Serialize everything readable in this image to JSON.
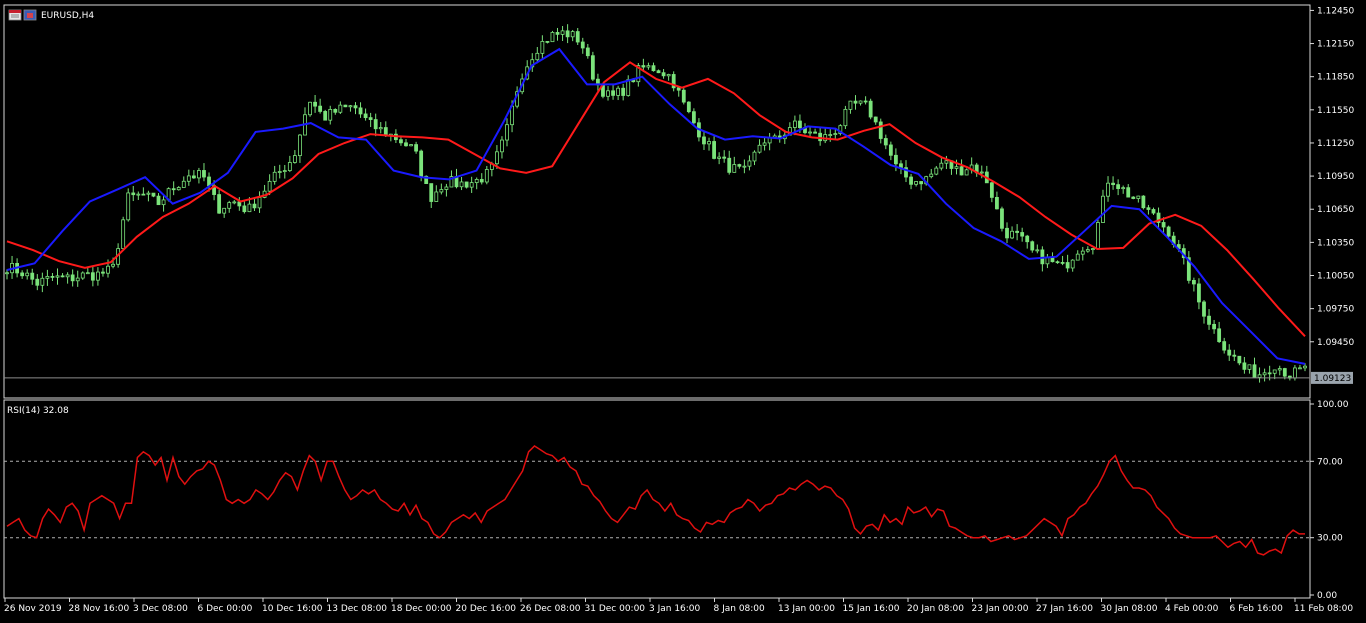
{
  "window": {
    "title": "EURUSD,H4",
    "icon": "chart-window-icon"
  },
  "colors": {
    "background": "#000000",
    "frame": "#d9d9d9",
    "bull_candle": "#7be37b",
    "ma_fast": "#1a1aff",
    "ma_slow": "#ff1a1a",
    "rsi_line": "#e01010",
    "level_line": "#b0b0b0",
    "price_tag_bg": "#9aa4ad"
  },
  "chart_data": [
    {
      "type": "candlestick",
      "symbol": "EURUSD",
      "timeframe": "H4",
      "y_ticks": [
        "1.12450",
        "1.12150",
        "1.11850",
        "1.11550",
        "1.11250",
        "1.10950",
        "1.10650",
        "1.10350",
        "1.10050",
        "1.09750",
        "1.09450"
      ],
      "ylim": [
        1.0895,
        1.1249
      ],
      "current_price": "1.09123",
      "current_price_value": 1.09123,
      "x_ticks": [
        "26 Nov 2019",
        "28 Nov 16:00",
        "3 Dec 08:00",
        "6 Dec 00:00",
        "10 Dec 16:00",
        "13 Dec 08:00",
        "18 Dec 00:00",
        "20 Dec 16:00",
        "26 Dec 08:00",
        "31 Dec 00:00",
        "3 Jan 16:00",
        "8 Jan 08:00",
        "13 Jan 00:00",
        "15 Jan 16:00",
        "20 Jan 08:00",
        "23 Jan 00:00",
        "27 Jan 16:00",
        "30 Jan 08:00",
        "4 Feb 00:00",
        "6 Feb 16:00",
        "11 Feb 08:00"
      ],
      "close_anchors": [
        1.1013,
        1.1008,
        1.0998,
        1.1003,
        1.1002,
        1.1005,
        1.1006,
        1.101,
        1.1075,
        1.1078,
        1.107,
        1.1084,
        1.1096,
        1.1095,
        1.1066,
        1.1072,
        1.1064,
        1.1082,
        1.1098,
        1.1112,
        1.1165,
        1.1148,
        1.1155,
        1.1158,
        1.1142,
        1.1135,
        1.1128,
        1.1118,
        1.1075,
        1.109,
        1.1088,
        1.109,
        1.1098,
        1.113,
        1.1185,
        1.121,
        1.1222,
        1.1225,
        1.1218,
        1.118,
        1.1165,
        1.1175,
        1.1193,
        1.1193,
        1.1185,
        1.1155,
        1.1132,
        1.1112,
        1.1102,
        1.1098,
        1.1128,
        1.1127,
        1.1142,
        1.1135,
        1.1128,
        1.1138,
        1.116,
        1.1158,
        1.113,
        1.11,
        1.109,
        1.1093,
        1.1108,
        1.11,
        1.1105,
        1.109,
        1.1045,
        1.104,
        1.1025,
        1.1018,
        1.1012,
        1.103,
        1.1035,
        1.1095,
        1.1082,
        1.1071,
        1.1058,
        1.1045,
        1.1015,
        1.098,
        1.0955,
        1.0935,
        1.092,
        1.0916,
        1.0925,
        1.0915,
        1.092
      ],
      "ma_fast": [
        1.101,
        1.1016,
        1.1045,
        1.1072,
        1.1083,
        1.1094,
        1.107,
        1.108,
        1.1098,
        1.1135,
        1.1138,
        1.1143,
        1.113,
        1.1128,
        1.11,
        1.1094,
        1.1092,
        1.11,
        1.1145,
        1.1195,
        1.121,
        1.1178,
        1.1178,
        1.1185,
        1.116,
        1.1138,
        1.1128,
        1.1131,
        1.1129,
        1.114,
        1.1138,
        1.1122,
        1.1105,
        1.1097,
        1.107,
        1.1048,
        1.1036,
        1.102,
        1.1022,
        1.1045,
        1.1068,
        1.1065,
        1.104,
        1.1013,
        1.098,
        1.0955,
        1.093,
        1.0925
      ],
      "ma_slow": [
        1.1036,
        1.1028,
        1.1018,
        1.1012,
        1.1017,
        1.104,
        1.1058,
        1.107,
        1.1086,
        1.1072,
        1.1078,
        1.1093,
        1.1115,
        1.1125,
        1.1133,
        1.1131,
        1.113,
        1.1128,
        1.1115,
        1.1102,
        1.1098,
        1.1104,
        1.1142,
        1.118,
        1.1198,
        1.1183,
        1.1175,
        1.1183,
        1.117,
        1.115,
        1.1135,
        1.113,
        1.1128,
        1.1136,
        1.1142,
        1.1125,
        1.1112,
        1.1103,
        1.109,
        1.1076,
        1.1058,
        1.1042,
        1.1029,
        1.103,
        1.1052,
        1.106,
        1.105,
        1.1028,
        1.1002,
        1.0975,
        1.095
      ]
    },
    {
      "type": "line",
      "title": "RSI(14) 32.08",
      "y_ticks": [
        "100.00",
        "70.00",
        "30.00",
        "0.00"
      ],
      "ylim": [
        0,
        100
      ],
      "levels": [
        70,
        30
      ],
      "series": [
        {
          "values": [
            36,
            38,
            40,
            34,
            31,
            30,
            40,
            45,
            42,
            38,
            46,
            48,
            44,
            34,
            48,
            50,
            52,
            50,
            48,
            40,
            48,
            48,
            72,
            75,
            73,
            68,
            72,
            60,
            72,
            62,
            58,
            62,
            65,
            66,
            70,
            68,
            60,
            50,
            48,
            50,
            48,
            50,
            55,
            53,
            50,
            54,
            60,
            64,
            62,
            55,
            65,
            73,
            70,
            60,
            70,
            70,
            62,
            55,
            50,
            52,
            55,
            53,
            55,
            50,
            48,
            45,
            44,
            48,
            42,
            47,
            40,
            38,
            32,
            30,
            33,
            38,
            40,
            42,
            40,
            43,
            38,
            44,
            46,
            48,
            50,
            55,
            60,
            65,
            75,
            78,
            76,
            74,
            73,
            70,
            72,
            67,
            65,
            58,
            57,
            52,
            49,
            44,
            40,
            38,
            42,
            46,
            45,
            52,
            55,
            50,
            48,
            44,
            48,
            42,
            40,
            39,
            35,
            33,
            38,
            37,
            39,
            38,
            43,
            45,
            46,
            50,
            48,
            44,
            47,
            48,
            52,
            53,
            56,
            55,
            58,
            60,
            58,
            55,
            57,
            56,
            52,
            50,
            45,
            35,
            32,
            36,
            37,
            34,
            42,
            38,
            40,
            37,
            46,
            43,
            44,
            46,
            41,
            45,
            44,
            36,
            35,
            33,
            31,
            30,
            30,
            31,
            28,
            29,
            30,
            31,
            29,
            30,
            31,
            34,
            37,
            40,
            38,
            36,
            31,
            40,
            42,
            46,
            48,
            53,
            57,
            63,
            70,
            73,
            65,
            60,
            56,
            56,
            55,
            52,
            46,
            43,
            40,
            35,
            32,
            31,
            30,
            30,
            30,
            30,
            31,
            28,
            25,
            27,
            28,
            25,
            29,
            22,
            21,
            23,
            24,
            22,
            31,
            34,
            32,
            32
          ]
        }
      ]
    }
  ]
}
